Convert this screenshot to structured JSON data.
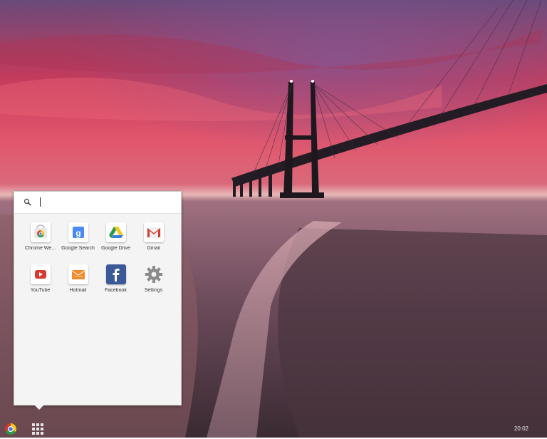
{
  "launcher": {
    "search": {
      "placeholder": ""
    },
    "apps": [
      {
        "label": "Chrome We...",
        "icon": "chrome-web-store-icon"
      },
      {
        "label": "Google Search",
        "icon": "google-search-icon"
      },
      {
        "label": "Google Drive",
        "icon": "google-drive-icon"
      },
      {
        "label": "Gmail",
        "icon": "gmail-icon"
      },
      {
        "label": "YouTube",
        "icon": "youtube-icon"
      },
      {
        "label": "Hotmail",
        "icon": "hotmail-icon"
      },
      {
        "label": "Facebook",
        "icon": "facebook-icon"
      },
      {
        "label": "Settings",
        "icon": "settings-gear-icon"
      }
    ]
  },
  "shelf": {
    "clock": "20:02"
  },
  "colors": {
    "sky_top": "#5a5a8c",
    "sky_red": "#e0506a",
    "water": "#7a5a6a"
  }
}
